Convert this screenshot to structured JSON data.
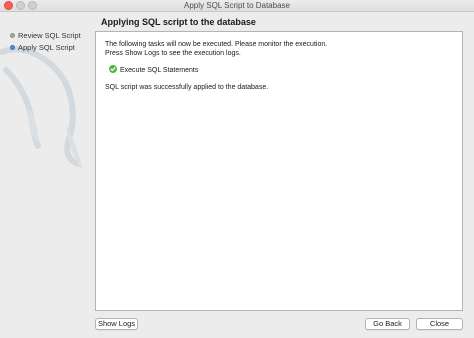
{
  "window": {
    "title": "Apply SQL Script to Database"
  },
  "sidebar": {
    "steps": [
      {
        "label": "Review SQL Script",
        "state": "done"
      },
      {
        "label": "Apply SQL Script",
        "state": "current"
      }
    ]
  },
  "main": {
    "title": "Applying SQL script to the database",
    "info_line1": "The following tasks will now be executed. Please monitor the execution.",
    "info_line2": "Press Show Logs to see the execution logs.",
    "task": {
      "label": "Execute SQL Statements",
      "status_icon": "success-check-icon",
      "status_color": "#4fb73d"
    },
    "result": "SQL script was successfully applied to the database."
  },
  "buttons": {
    "show_logs": "Show Logs",
    "go_back": "Go Back",
    "close": "Close"
  },
  "colors": {
    "window_bg": "#ececec",
    "panel_bg": "#ffffff",
    "close_traffic": "#fd5f57",
    "current_step": "#5a8ed8"
  }
}
